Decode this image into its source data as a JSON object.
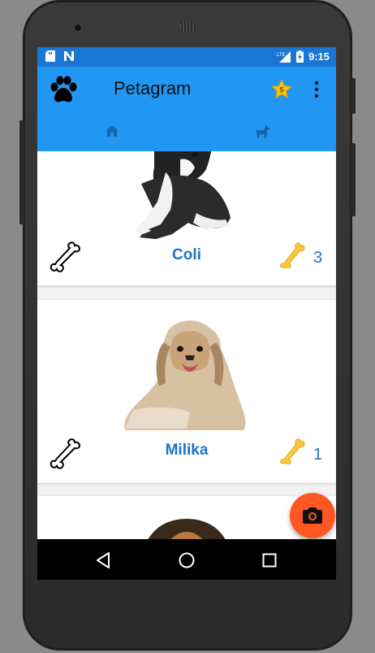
{
  "status_bar": {
    "time": "9:15",
    "network": "LTE",
    "icons": [
      "sd-card-icon",
      "n-notification-icon",
      "signal-icon",
      "battery-charging-icon"
    ]
  },
  "app_bar": {
    "title": "Petagram",
    "logo_icon": "paw-icon",
    "favorites_badge": "5",
    "more_icon": "more-vert-icon"
  },
  "tabs": [
    {
      "icon": "home-icon",
      "selected": true
    },
    {
      "icon": "dog-icon",
      "selected": false
    }
  ],
  "pets": [
    {
      "name": "Coli",
      "likes": "3"
    },
    {
      "name": "Milika",
      "likes": "1"
    },
    {
      "name": "",
      "likes": ""
    }
  ],
  "fab": {
    "icon": "camera-icon"
  },
  "nav": {
    "back": "back-icon",
    "home": "home-circle-icon",
    "recents": "recents-icon"
  },
  "colors": {
    "primary": "#2196f3",
    "primary_dark": "#1976d2",
    "accent": "#ff5722",
    "text_blue": "#1e73c6"
  }
}
